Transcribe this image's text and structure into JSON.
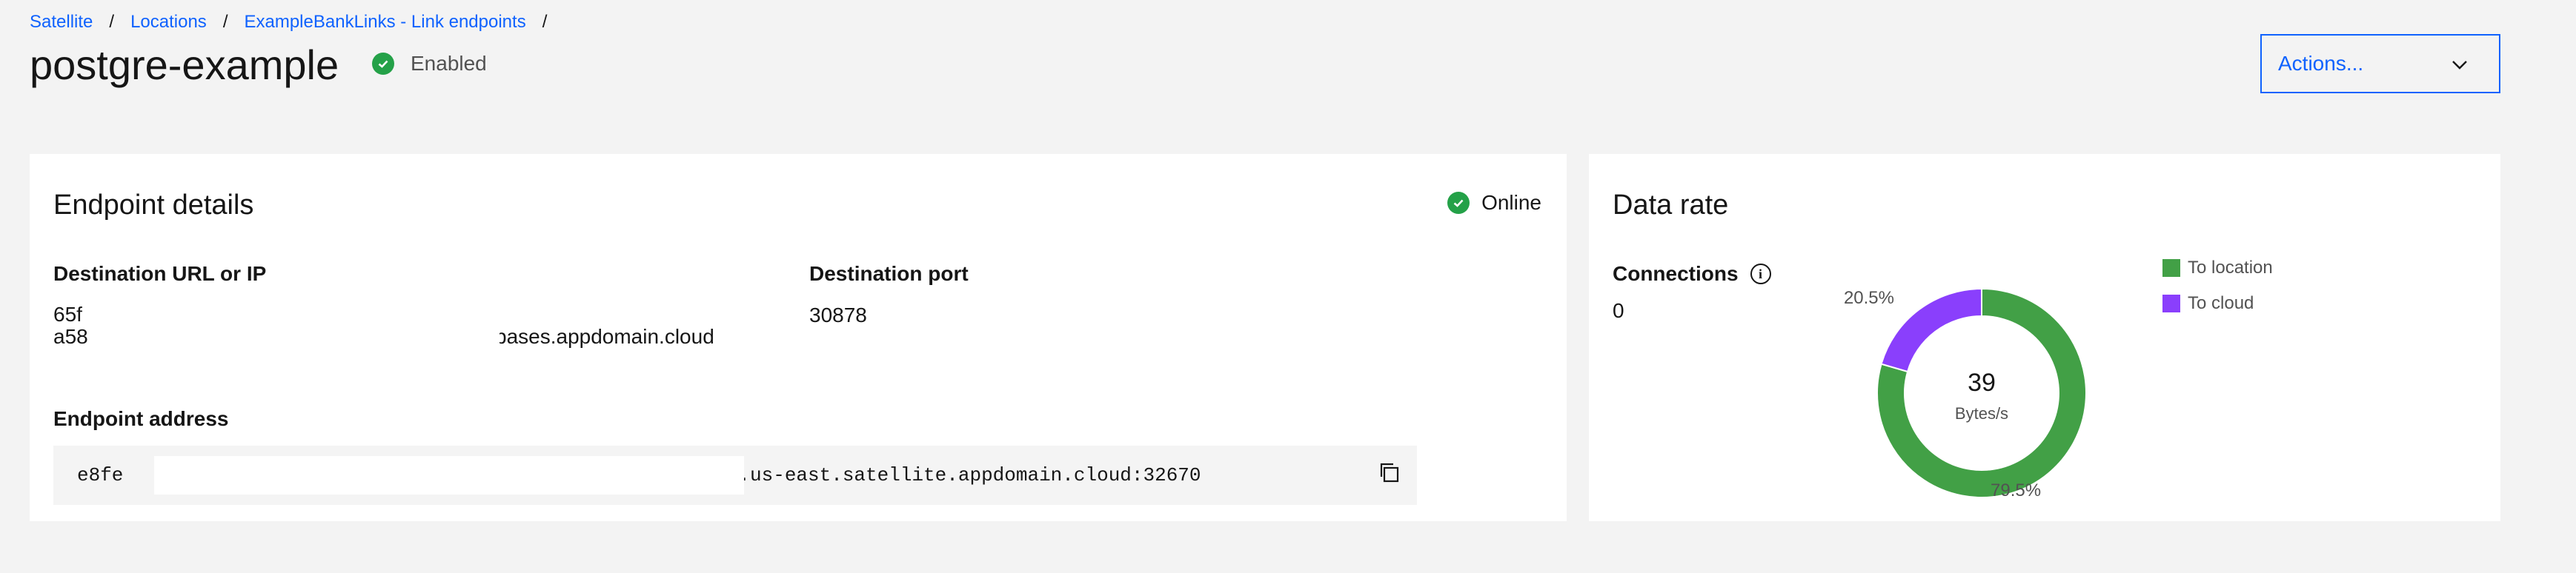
{
  "breadcrumb": {
    "items": [
      "Satellite",
      "Locations",
      "ExampleBankLinks - Link endpoints"
    ],
    "separator": "/"
  },
  "header": {
    "title": "postgre-example",
    "status": "Enabled",
    "status_color": "#24a148",
    "actions_label": "Actions..."
  },
  "endpoint_details": {
    "title": "Endpoint details",
    "online_status": "Online",
    "destination_url_label": "Destination URL or IP",
    "destination_url_line1": "65f",
    "destination_url_line2_prefix": "a58",
    "destination_url_line2_suffix": "bases.appdomain.cloud",
    "destination_port_label": "Destination port",
    "destination_port": "30878",
    "endpoint_address_label": "Endpoint address",
    "endpoint_address_prefix": "e8fe",
    "endpoint_address_suffix": "c000.us-east.satellite.appdomain.cloud:32670",
    "copy_icon": "copy-icon"
  },
  "data_rate": {
    "title": "Data rate",
    "connections_label": "Connections",
    "connections_value": "0",
    "info_icon": "info-icon",
    "center_value": "39",
    "center_unit": "Bytes/s",
    "to_location_pct_label": "79.5%",
    "to_cloud_pct_label": "20.5%",
    "legend": [
      {
        "label": "To location",
        "color": "#42a046"
      },
      {
        "label": "To cloud",
        "color": "#8a3ffc"
      }
    ]
  },
  "chart_data": {
    "type": "pie",
    "categories": [
      "To location",
      "To cloud"
    ],
    "values": [
      79.5,
      20.5
    ],
    "colors": [
      "#42a046",
      "#8a3ffc"
    ],
    "center_label": "39",
    "center_sublabel": "Bytes/s"
  }
}
